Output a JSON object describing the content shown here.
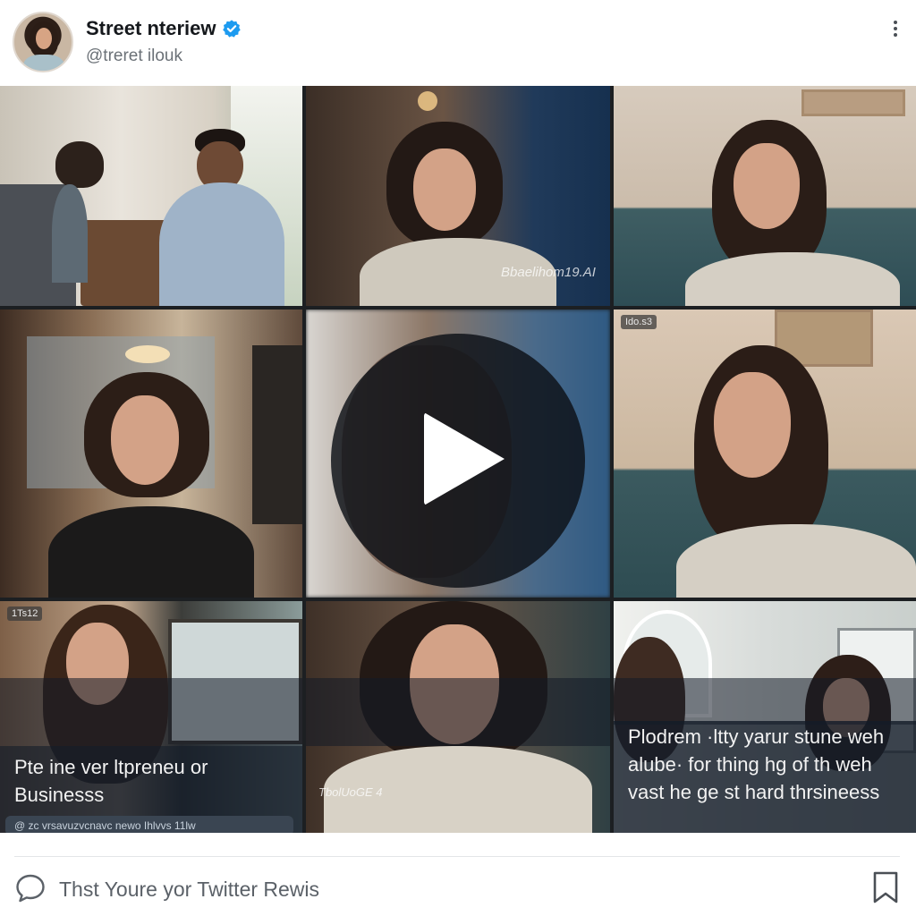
{
  "header": {
    "title": "Street nteriew",
    "handle": "@treret ilouk",
    "verified_icon": "verified-badge-icon",
    "more_icon": "more-vertical-icon",
    "accent_color": "#1d9bf0"
  },
  "grid": {
    "tiles": [
      {
        "tag": "",
        "watermark": ""
      },
      {
        "tag": "",
        "watermark": "Bbaelihom19.AI"
      },
      {
        "tag": "",
        "watermark": ""
      },
      {
        "tag": "",
        "watermark": ""
      },
      {
        "tag": "",
        "watermark": ""
      },
      {
        "tag": "Ido.s3",
        "watermark": ""
      },
      {
        "tag": "1Ts12",
        "watermark": ""
      },
      {
        "tag": "",
        "watermark": "TbolUoGE 4"
      },
      {
        "tag": "",
        "watermark": ""
      }
    ],
    "caption_left": "Pte ine ver ltpreneu or Businesss",
    "caption_right": "Plodrem ·ltty yarur stune weh alube· for thing hg of th weh vast he ge st hard thrsineess",
    "chip_text": "@ zc vrsavuzvcnavc newo Ihlvvs 11lw",
    "play_icon": "play-icon"
  },
  "footer": {
    "text": "Thst Youre yor Twitter Rewis",
    "reply_icon": "reply-bubble-icon",
    "bookmark_icon": "bookmark-icon"
  }
}
